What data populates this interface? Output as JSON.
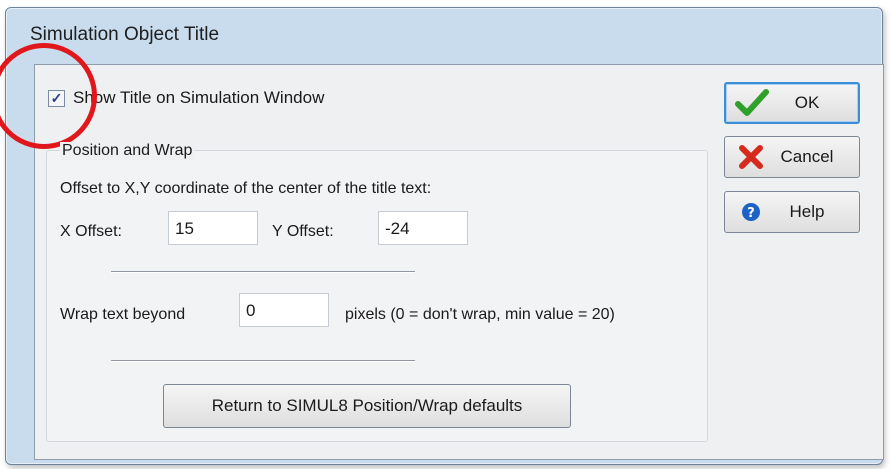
{
  "dialog": {
    "title": "Simulation Object Title"
  },
  "show_title": {
    "label": "Show Title on Simulation Window",
    "checked": true
  },
  "position_wrap": {
    "group_label": "Position and Wrap",
    "description": "Offset to X,Y coordinate of the center of the title text:",
    "x_offset_label": "X Offset:",
    "x_offset_value": "15",
    "y_offset_label": "Y Offset:",
    "y_offset_value": "-24",
    "wrap_label": "Wrap text beyond",
    "wrap_value": "0",
    "wrap_hint": "pixels (0 = don't wrap, min value = 20)",
    "defaults_button": "Return to SIMUL8 Position/Wrap defaults"
  },
  "buttons": {
    "ok": "OK",
    "cancel": "Cancel",
    "help": "Help"
  },
  "icons": {
    "ok": "green-checkmark-icon",
    "cancel": "red-x-icon",
    "help": "blue-help-icon"
  },
  "colors": {
    "highlight": "#e0181c",
    "focus": "#3c8fd6"
  }
}
